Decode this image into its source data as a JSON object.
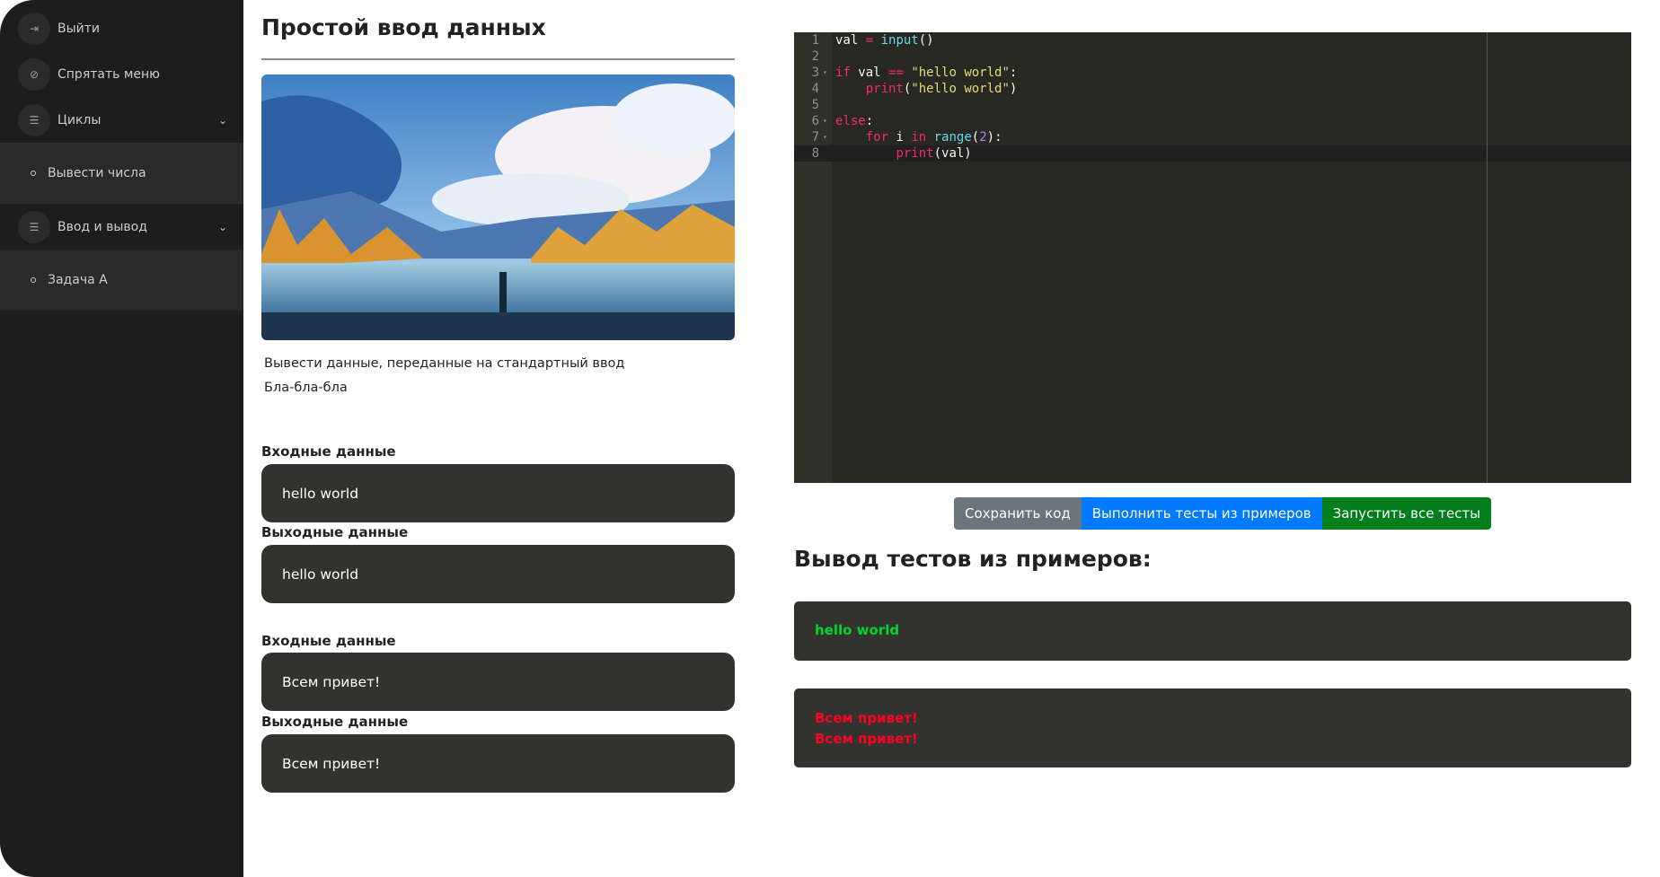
{
  "sidebar": {
    "items": [
      {
        "label": "Выйти",
        "icon": "logout-icon"
      },
      {
        "label": "Спрятать меню",
        "icon": "eye-off-icon"
      },
      {
        "label": "Циклы",
        "icon": "list-icon",
        "sub": [
          "Вывести числа"
        ]
      },
      {
        "label": "Ввод и вывод",
        "icon": "list-icon",
        "sub": [
          "Задача A"
        ]
      }
    ]
  },
  "task": {
    "title": "Простой ввод данных",
    "description": [
      "Вывести данные, переданные на стандартный ввод",
      "Бла-бла-бла"
    ],
    "examples": [
      {
        "input_label": "Входные данные",
        "input": "hello world",
        "output_label": "Выходные данные",
        "output": "hello world"
      },
      {
        "input_label": "Входные данные",
        "input": "Всем привет!",
        "output_label": "Выходные данные",
        "output": "Всем привет!"
      }
    ]
  },
  "editor": {
    "line_numbers": [
      "1",
      "2",
      "3",
      "4",
      "5",
      "6",
      "7",
      "8"
    ],
    "lines": [
      "val = input()",
      "",
      "if val == \"hello world\":",
      "    print(\"hello world\")",
      "",
      "else:",
      "    for i in range(2):",
      "        print(val)"
    ]
  },
  "buttons": {
    "save": "Сохранить код",
    "run_examples": "Выполнить тесты из примеров",
    "run_all": "Запустить все тесты"
  },
  "results": {
    "title": "Вывод тестов из примеров:",
    "items": [
      {
        "lines": [
          "hello world"
        ],
        "status": "passed",
        "color": "#00d62e"
      },
      {
        "lines": [
          "Всем привет!",
          "Всем привет!"
        ],
        "status": "failed",
        "color": "#ff0022"
      }
    ]
  },
  "colors": {
    "save": "#6c757d",
    "run_examples": "#007bff",
    "run_all": "#007e1c"
  }
}
